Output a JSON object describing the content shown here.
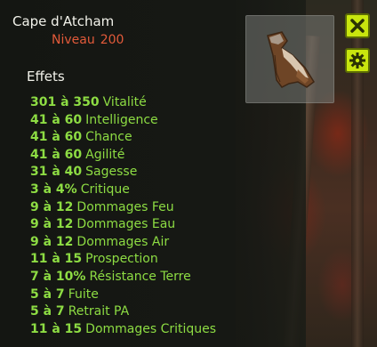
{
  "item": {
    "name": "Cape d'Atcham",
    "level_label": "Niveau",
    "level_value": "200"
  },
  "effects_header": "Effets",
  "effects": [
    {
      "range": "301 à 350",
      "stat": "Vitalité"
    },
    {
      "range": "41 à 60",
      "stat": "Intelligence"
    },
    {
      "range": "41 à 60",
      "stat": "Chance"
    },
    {
      "range": "41 à 60",
      "stat": "Agilité"
    },
    {
      "range": "31 à 40",
      "stat": "Sagesse"
    },
    {
      "range": "3 à 4%",
      "stat": "Critique"
    },
    {
      "range": "9 à 12",
      "stat": "Dommages Feu"
    },
    {
      "range": "9 à 12",
      "stat": "Dommages Eau"
    },
    {
      "range": "9 à 12",
      "stat": "Dommages Air"
    },
    {
      "range": "11 à 15",
      "stat": "Prospection"
    },
    {
      "range": "7 à 10%",
      "stat": "Résistance Terre"
    },
    {
      "range": "5 à 7",
      "stat": "Fuite"
    },
    {
      "range": "5 à 7",
      "stat": "Retrait PA"
    },
    {
      "range": "11 à 15",
      "stat": "Dommages Critiques"
    }
  ],
  "buttons": {
    "close_icon": "close-icon",
    "settings_icon": "gear-icon"
  },
  "colors": {
    "effect_green": "#8ddc43",
    "level_red": "#e25a3a",
    "button_yellow": "#c8e60e"
  }
}
